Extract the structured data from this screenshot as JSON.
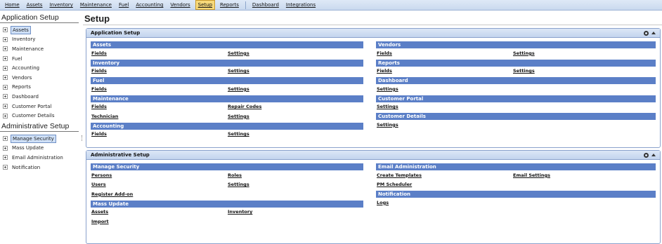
{
  "menu": [
    "Home",
    "Assets",
    "Inventory",
    "Maintenance",
    "Fuel",
    "Accounting",
    "Vendors",
    "Setup",
    "Reports",
    "Dashboard",
    "Integrations"
  ],
  "sidebar": {
    "app_heading": "Application Setup",
    "app_items": [
      "Assets",
      "Inventory",
      "Maintenance",
      "Fuel",
      "Accounting",
      "Vendors",
      "Reports",
      "Dashboard",
      "Customer Portal",
      "Customer Details"
    ],
    "admin_heading": "Administrative Setup",
    "admin_items": [
      "Manage Security",
      "Mass Update",
      "Email Administration",
      "Notification"
    ]
  },
  "page_title": "Setup",
  "panels": {
    "app": {
      "title": "Application Setup",
      "left": [
        {
          "title": "Assets",
          "rows": [
            [
              "Fields",
              "Settings"
            ]
          ]
        },
        {
          "title": "Inventory",
          "rows": [
            [
              "Fields",
              "Settings"
            ]
          ]
        },
        {
          "title": "Fuel",
          "rows": [
            [
              "Fields",
              "Settings"
            ]
          ]
        },
        {
          "title": "Maintenance",
          "rows": [
            [
              "Fields",
              "Repair Codes"
            ],
            [
              "Technician",
              "Settings"
            ]
          ]
        },
        {
          "title": "Accounting",
          "rows": [
            [
              "Fields",
              "Settings"
            ]
          ]
        }
      ],
      "right": [
        {
          "title": "Vendors",
          "rows": [
            [
              "Fields",
              "Settings"
            ]
          ]
        },
        {
          "title": "Reports",
          "rows": [
            [
              "Fields",
              "Settings"
            ]
          ]
        },
        {
          "title": "Dashboard",
          "rows": [
            [
              "Settings"
            ]
          ]
        },
        {
          "title": "Customer Portal",
          "rows": [
            [
              "Settings"
            ]
          ]
        },
        {
          "title": "Customer Details",
          "rows": [
            [
              "Settings"
            ]
          ]
        }
      ]
    },
    "admin": {
      "title": "Administrative Setup",
      "left": [
        {
          "title": "Manage Security",
          "rows": [
            [
              "Persons",
              "Roles"
            ],
            [
              "Users",
              "Settings"
            ],
            [
              "Register Add-on"
            ]
          ]
        },
        {
          "title": "Mass Update",
          "rows": [
            [
              "Assets",
              "Inventory"
            ],
            [
              "Import"
            ]
          ]
        }
      ],
      "right": [
        {
          "title": "Email Administration",
          "rows": [
            [
              "Create Templates",
              "Email Settings"
            ],
            [
              "PM Scheduler"
            ]
          ]
        },
        {
          "title": "Notification",
          "rows": [
            [
              "Logs"
            ]
          ]
        }
      ]
    }
  }
}
